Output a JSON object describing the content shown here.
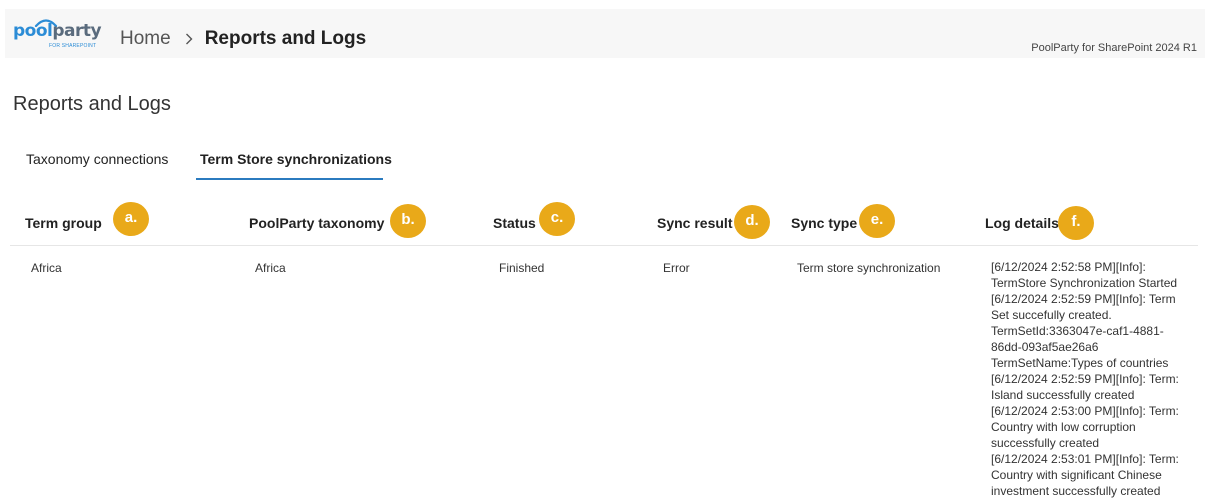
{
  "header": {
    "logo": {
      "word_left": "pool",
      "word_right": "party",
      "sub": "FOR SHAREPOINT"
    },
    "breadcrumb": {
      "home": "Home",
      "current": "Reports and Logs"
    },
    "version": "PoolParty for SharePoint 2024 R1",
    "colors": {
      "brand_blue": "#2b8cd6",
      "header_bg": "#f7f7f7"
    }
  },
  "page_title": "Reports and Logs",
  "tabs": [
    {
      "label": "Taxonomy connections",
      "selected": false
    },
    {
      "label": "Term Store synchronizations",
      "selected": true
    }
  ],
  "table": {
    "columns": [
      {
        "label": "Term group",
        "badge": "a."
      },
      {
        "label": "PoolParty taxonomy",
        "badge": "b."
      },
      {
        "label": "Status",
        "badge": "c."
      },
      {
        "label": "Sync result",
        "badge": "d."
      },
      {
        "label": "Sync type",
        "badge": "e."
      },
      {
        "label": "Log details",
        "badge": "f."
      }
    ],
    "badge_color": "#e9a919",
    "rows": [
      {
        "term_group": "Africa",
        "taxonomy": "Africa",
        "status": "Finished",
        "sync_result": "Error",
        "sync_type": "Term store synchronization",
        "log_lines": [
          "[6/12/2024 2:52:58 PM][Info]:",
          "TermStore Synchronization Started",
          "[6/12/2024 2:52:59 PM][Info]: Term",
          "Set succefully created.",
          "TermSetId:3363047e-caf1-4881-",
          "86dd-093af5ae26a6",
          "TermSetName:Types of countries",
          "[6/12/2024 2:52:59 PM][Info]: Term:",
          "Island successfully created",
          "[6/12/2024 2:53:00 PM][Info]: Term:",
          "Country with low corruption",
          "successfully created",
          "[6/12/2024 2:53:01 PM][Info]: Term:",
          "Country with significant Chinese",
          "investment successfully created"
        ]
      }
    ]
  }
}
